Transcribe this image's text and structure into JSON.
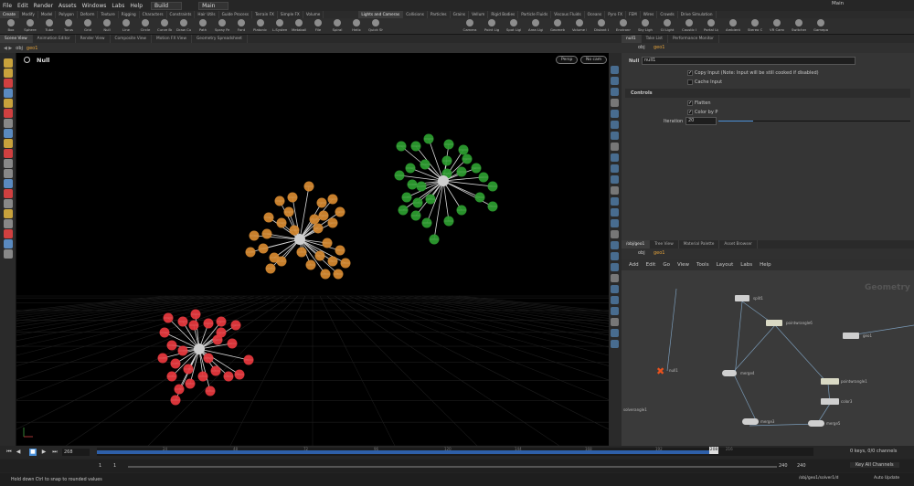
{
  "menubar": {
    "items": [
      "File",
      "Edit",
      "Render",
      "Assets",
      "Windows",
      "Labs",
      "Help"
    ],
    "desktop": "Build",
    "desktop_right": "Main",
    "tab_main": "Main"
  },
  "shelf": {
    "tabs_left": [
      "Create",
      "Modify",
      "Model",
      "Polygon",
      "Deform",
      "Texture",
      "Rigging",
      "Characters",
      "Constraints",
      "Hair Utils",
      "Guide Process",
      "Terrain FX",
      "Simple FX",
      "Volume"
    ],
    "tabs_right": [
      "Lights and Cameras",
      "Collisions",
      "Particles",
      "Grains",
      "Vellum",
      "Rigid Bodies",
      "Particle Fluids",
      "Viscous Fluids",
      "Oceans",
      "Pyro FX",
      "FEM",
      "Wires",
      "Crowds",
      "Drive Simulation"
    ],
    "tools_left": [
      "Box",
      "Sphere",
      "Tube",
      "Torus",
      "Grid",
      "Null",
      "Line",
      "Circle",
      "Curve Bezier",
      "Draw Curve",
      "Path",
      "Spray Paint",
      "Font",
      "Platonic Solids",
      "L-System",
      "Metaball",
      "File",
      "Spiral",
      "Helix",
      "Quick Shapes"
    ],
    "tools_right": [
      "Camera",
      "Point Light",
      "Spot Light",
      "Area Light",
      "Geometry Light",
      "Volume Light",
      "Distant Light",
      "Environment Light",
      "Sky Light",
      "GI Light",
      "Caustic Light",
      "Portal Light",
      "Ambient Light",
      "Stereo Camera",
      "VR Camera",
      "Switcher",
      "Gamepad Camera"
    ]
  },
  "viewport": {
    "tabs": [
      "Scene View",
      "Animation Editor",
      "Render View",
      "Composite View",
      "Motion FX View",
      "Geometry Spreadsheet"
    ],
    "path": [
      "obj",
      "geo1"
    ],
    "node_name": "Null",
    "persp": "Persp",
    "cam": "No cam"
  },
  "params": {
    "tabs": [
      "null1",
      "Take List",
      "Performance Monitor"
    ],
    "path": [
      "obj",
      "geo1"
    ],
    "node_type": "Null",
    "node_field": "null1",
    "copy_input": "Copy Input (Note: Input will be still cooked if disabled)",
    "cache_input": "Cache Input",
    "section": "Controls",
    "flatten": "Flatten",
    "color_by_p": "Color by P",
    "iteration_label": "Iteration",
    "iteration_value": "20",
    "iteration_fraction": 0.18
  },
  "network": {
    "tabs": [
      "/obj/geo1",
      "Tree View",
      "Material Palette",
      "Asset Browser"
    ],
    "path": [
      "obj",
      "geo1"
    ],
    "menu": [
      "Add",
      "Edit",
      "Go",
      "View",
      "Tools",
      "Layout",
      "Labs",
      "Help"
    ],
    "watermark": "Geometry",
    "nodes": {
      "split": "split1",
      "wrangle": "pointwrangle6",
      "geo": "geo1",
      "null": "null1",
      "merge4": "merge4",
      "wrangle2": "pointwrangle1",
      "color": "color3",
      "merge3": "merge3",
      "merge5": "merge5",
      "solver": "solverangle1"
    }
  },
  "timeline": {
    "start_frame": "1",
    "current_frame": "268",
    "ticks": [
      "24",
      "48",
      "72",
      "96",
      "120",
      "144",
      "168",
      "192",
      "216"
    ],
    "end_frame": "240",
    "end_frame2": "240",
    "current_marker": "208",
    "keys_label": "0 keys, 0/0 channels",
    "key_all": "Key All Channels",
    "auto_update": "Auto Update",
    "path_status": "/obj/geo1/solver1/d"
  },
  "status": {
    "hint": "Hold down Ctrl to snap to rounded values"
  },
  "colors": {
    "red": "#e3373c",
    "orange": "#d2862e",
    "green": "#2b9a2e",
    "timeline_blue": "#2e5fa8"
  }
}
